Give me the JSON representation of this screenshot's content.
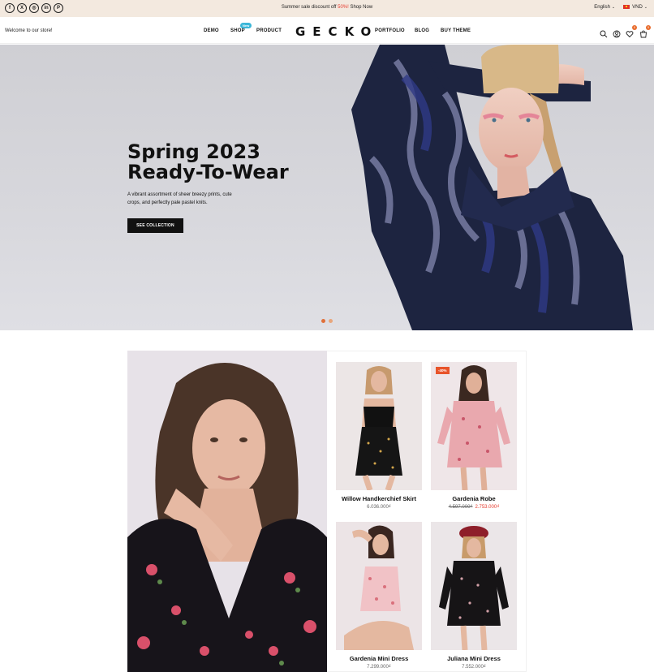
{
  "topbar": {
    "socials": [
      {
        "icon": "facebook-icon",
        "glyph": "f"
      },
      {
        "icon": "x-icon",
        "glyph": "X"
      },
      {
        "icon": "instagram-icon",
        "glyph": "◎"
      },
      {
        "icon": "linkedin-icon",
        "glyph": "in"
      },
      {
        "icon": "pinterest-icon",
        "glyph": "P"
      }
    ],
    "promo_text": "Summer sale discount off ",
    "promo_highlight": "50%!",
    "promo_link": "Shop Now",
    "language": "English",
    "currency": "VND"
  },
  "header": {
    "welcome": "Welcome to our store!",
    "nav": {
      "demo": "DEMO",
      "shop": "SHOP",
      "shop_badge": "New",
      "product": "PRODUCT",
      "portfolio": "PORTFOLIO",
      "blog": "BLOG",
      "buytheme": "BUY THEME"
    },
    "logo": "GECKO",
    "wishlist_count": "0",
    "cart_count": "0"
  },
  "hero": {
    "title_line1": "Spring 2023",
    "title_line2": "Ready-To-Wear",
    "description": "A vibrant assortment of sheer breezy prints, cute crops, and perfectly pale pastel knits.",
    "button": "SEE COLLECTION",
    "slide_count": 2,
    "active_slide": 1
  },
  "products": [
    {
      "name": "Willow Handkerchief Skirt",
      "price": "6.036.000₫",
      "old_price": null,
      "sale_tag": null
    },
    {
      "name": "Gardenia Robe",
      "price": "2.753.000₫",
      "old_price": "4.597.000₫",
      "sale_tag": "-40%"
    },
    {
      "name": "Gardenia Mini Dress",
      "price": "7.299.000₫",
      "old_price": null,
      "sale_tag": null
    },
    {
      "name": "Juliana Mini Dress",
      "price": "7.552.000₫",
      "old_price": null,
      "sale_tag": null
    }
  ],
  "colors": {
    "topbar_bg": "#f3e9df",
    "accent": "#e86a2a",
    "sale": "#e63b2e",
    "new_badge": "#3ab6d8"
  }
}
